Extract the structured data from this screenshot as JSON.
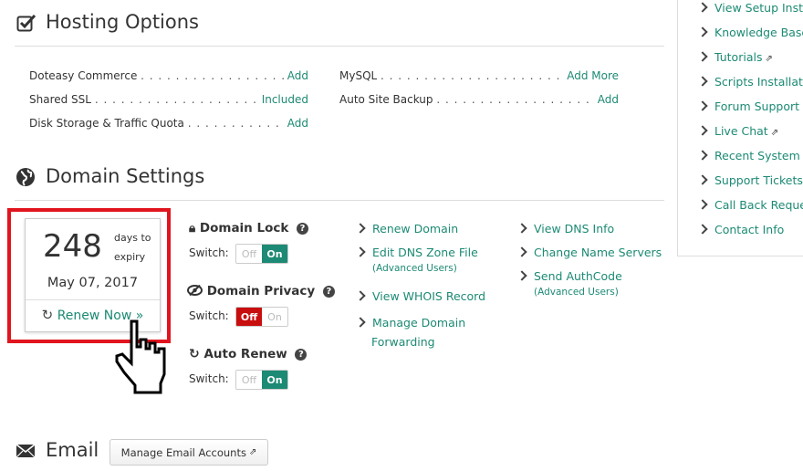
{
  "hosting": {
    "title": "Hosting Options",
    "left_rows": [
      {
        "label": "Doteasy Commerce",
        "dots": ". . . . . . . . . . . . . . . . . . . .",
        "action": "Add"
      },
      {
        "label": "Shared SSL",
        "dots": ". . . . . . . . . . . . . . . . . . . . . . . . . .",
        "action": "Included"
      },
      {
        "label": "Disk Storage & Traffic Quota",
        "dots": ". . . . . . . . . . . . . . . .",
        "action": "Add"
      }
    ],
    "right_rows": [
      {
        "label": "MySQL",
        "dots": ". . . . . . . . . . . . . . . . . . . . . . . . . . . .",
        "action": "Add More"
      },
      {
        "label": "Auto Site Backup",
        "dots": ". . . . . . . . . . . . . . . . . . . . . . . .",
        "action": "Add"
      }
    ]
  },
  "domain": {
    "title": "Domain Settings",
    "expiry": {
      "days": "248",
      "days_label_1": "days to",
      "days_label_2": "expiry",
      "date": "May 07, 2017",
      "renew_label": "Renew Now »"
    },
    "lock": {
      "title": "Domain Lock",
      "switch_label": "Switch:",
      "off": "Off",
      "on": "On",
      "state": "on"
    },
    "privacy": {
      "title": "Domain Privacy",
      "switch_label": "Switch:",
      "off": "Off",
      "on": "On",
      "state": "off"
    },
    "autorenew": {
      "title": "Auto Renew",
      "switch_label": "Switch:",
      "off": "Off",
      "on": "On",
      "state": "on"
    },
    "links_col1": [
      {
        "label": "Renew Domain"
      },
      {
        "label": "Edit DNS Zone File",
        "sub": "(Advanced Users)"
      },
      {
        "label": "View WHOIS Record"
      },
      {
        "label": "Manage Domain",
        "label2": "Forwarding"
      }
    ],
    "links_col2": [
      {
        "label": "View DNS Info"
      },
      {
        "label": "Change Name Servers"
      },
      {
        "label": "Send AuthCode",
        "sub": "(Advanced Users)"
      }
    ]
  },
  "email": {
    "title": "Email",
    "manage_button": "Manage Email Accounts"
  },
  "sidebar": {
    "items": [
      "View Setup Instru",
      "Knowledge Base",
      "Tutorials",
      "Scripts Installatio",
      "Forum Support",
      "Live Chat",
      "Recent System M",
      "Support Tickets",
      "Call Back Reques",
      "Contact Info"
    ]
  },
  "colors": {
    "accent": "#1c8a74",
    "off_red": "#c80e0e",
    "highlight_box": "#e1151e"
  }
}
